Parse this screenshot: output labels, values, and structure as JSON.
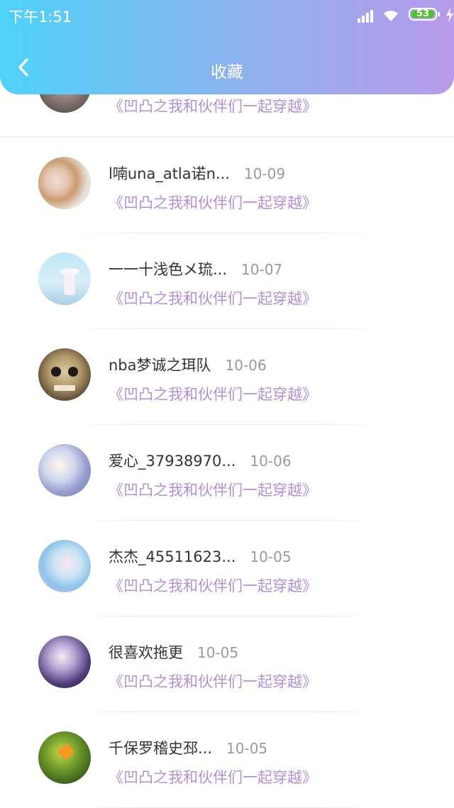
{
  "status_bar": {
    "time": "下午1:51",
    "battery": "53"
  },
  "header": {
    "title": "收藏"
  },
  "items": [
    {
      "name": "",
      "date": "",
      "book": "《凹凸之我和伙伴们一起穿越》"
    },
    {
      "name": "l喃una_atla诺n...",
      "date": "10-09",
      "book": "《凹凸之我和伙伴们一起穿越》"
    },
    {
      "name": "一一十浅色メ琉...",
      "date": "10-07",
      "book": "《凹凸之我和伙伴们一起穿越》"
    },
    {
      "name": "nba梦诚之珥队",
      "date": "10-06",
      "book": "《凹凸之我和伙伴们一起穿越》"
    },
    {
      "name": "爱心_37938970...",
      "date": "10-06",
      "book": "《凹凸之我和伙伴们一起穿越》"
    },
    {
      "name": "杰杰_45511623...",
      "date": "10-05",
      "book": "《凹凸之我和伙伴们一起穿越》"
    },
    {
      "name": "很喜欢拖更",
      "date": "10-05",
      "book": "《凹凸之我和伙伴们一起穿越》"
    },
    {
      "name": "千保罗稽史邳...",
      "date": "10-05",
      "book": "《凹凸之我和伙伴们一起穿越》"
    }
  ]
}
